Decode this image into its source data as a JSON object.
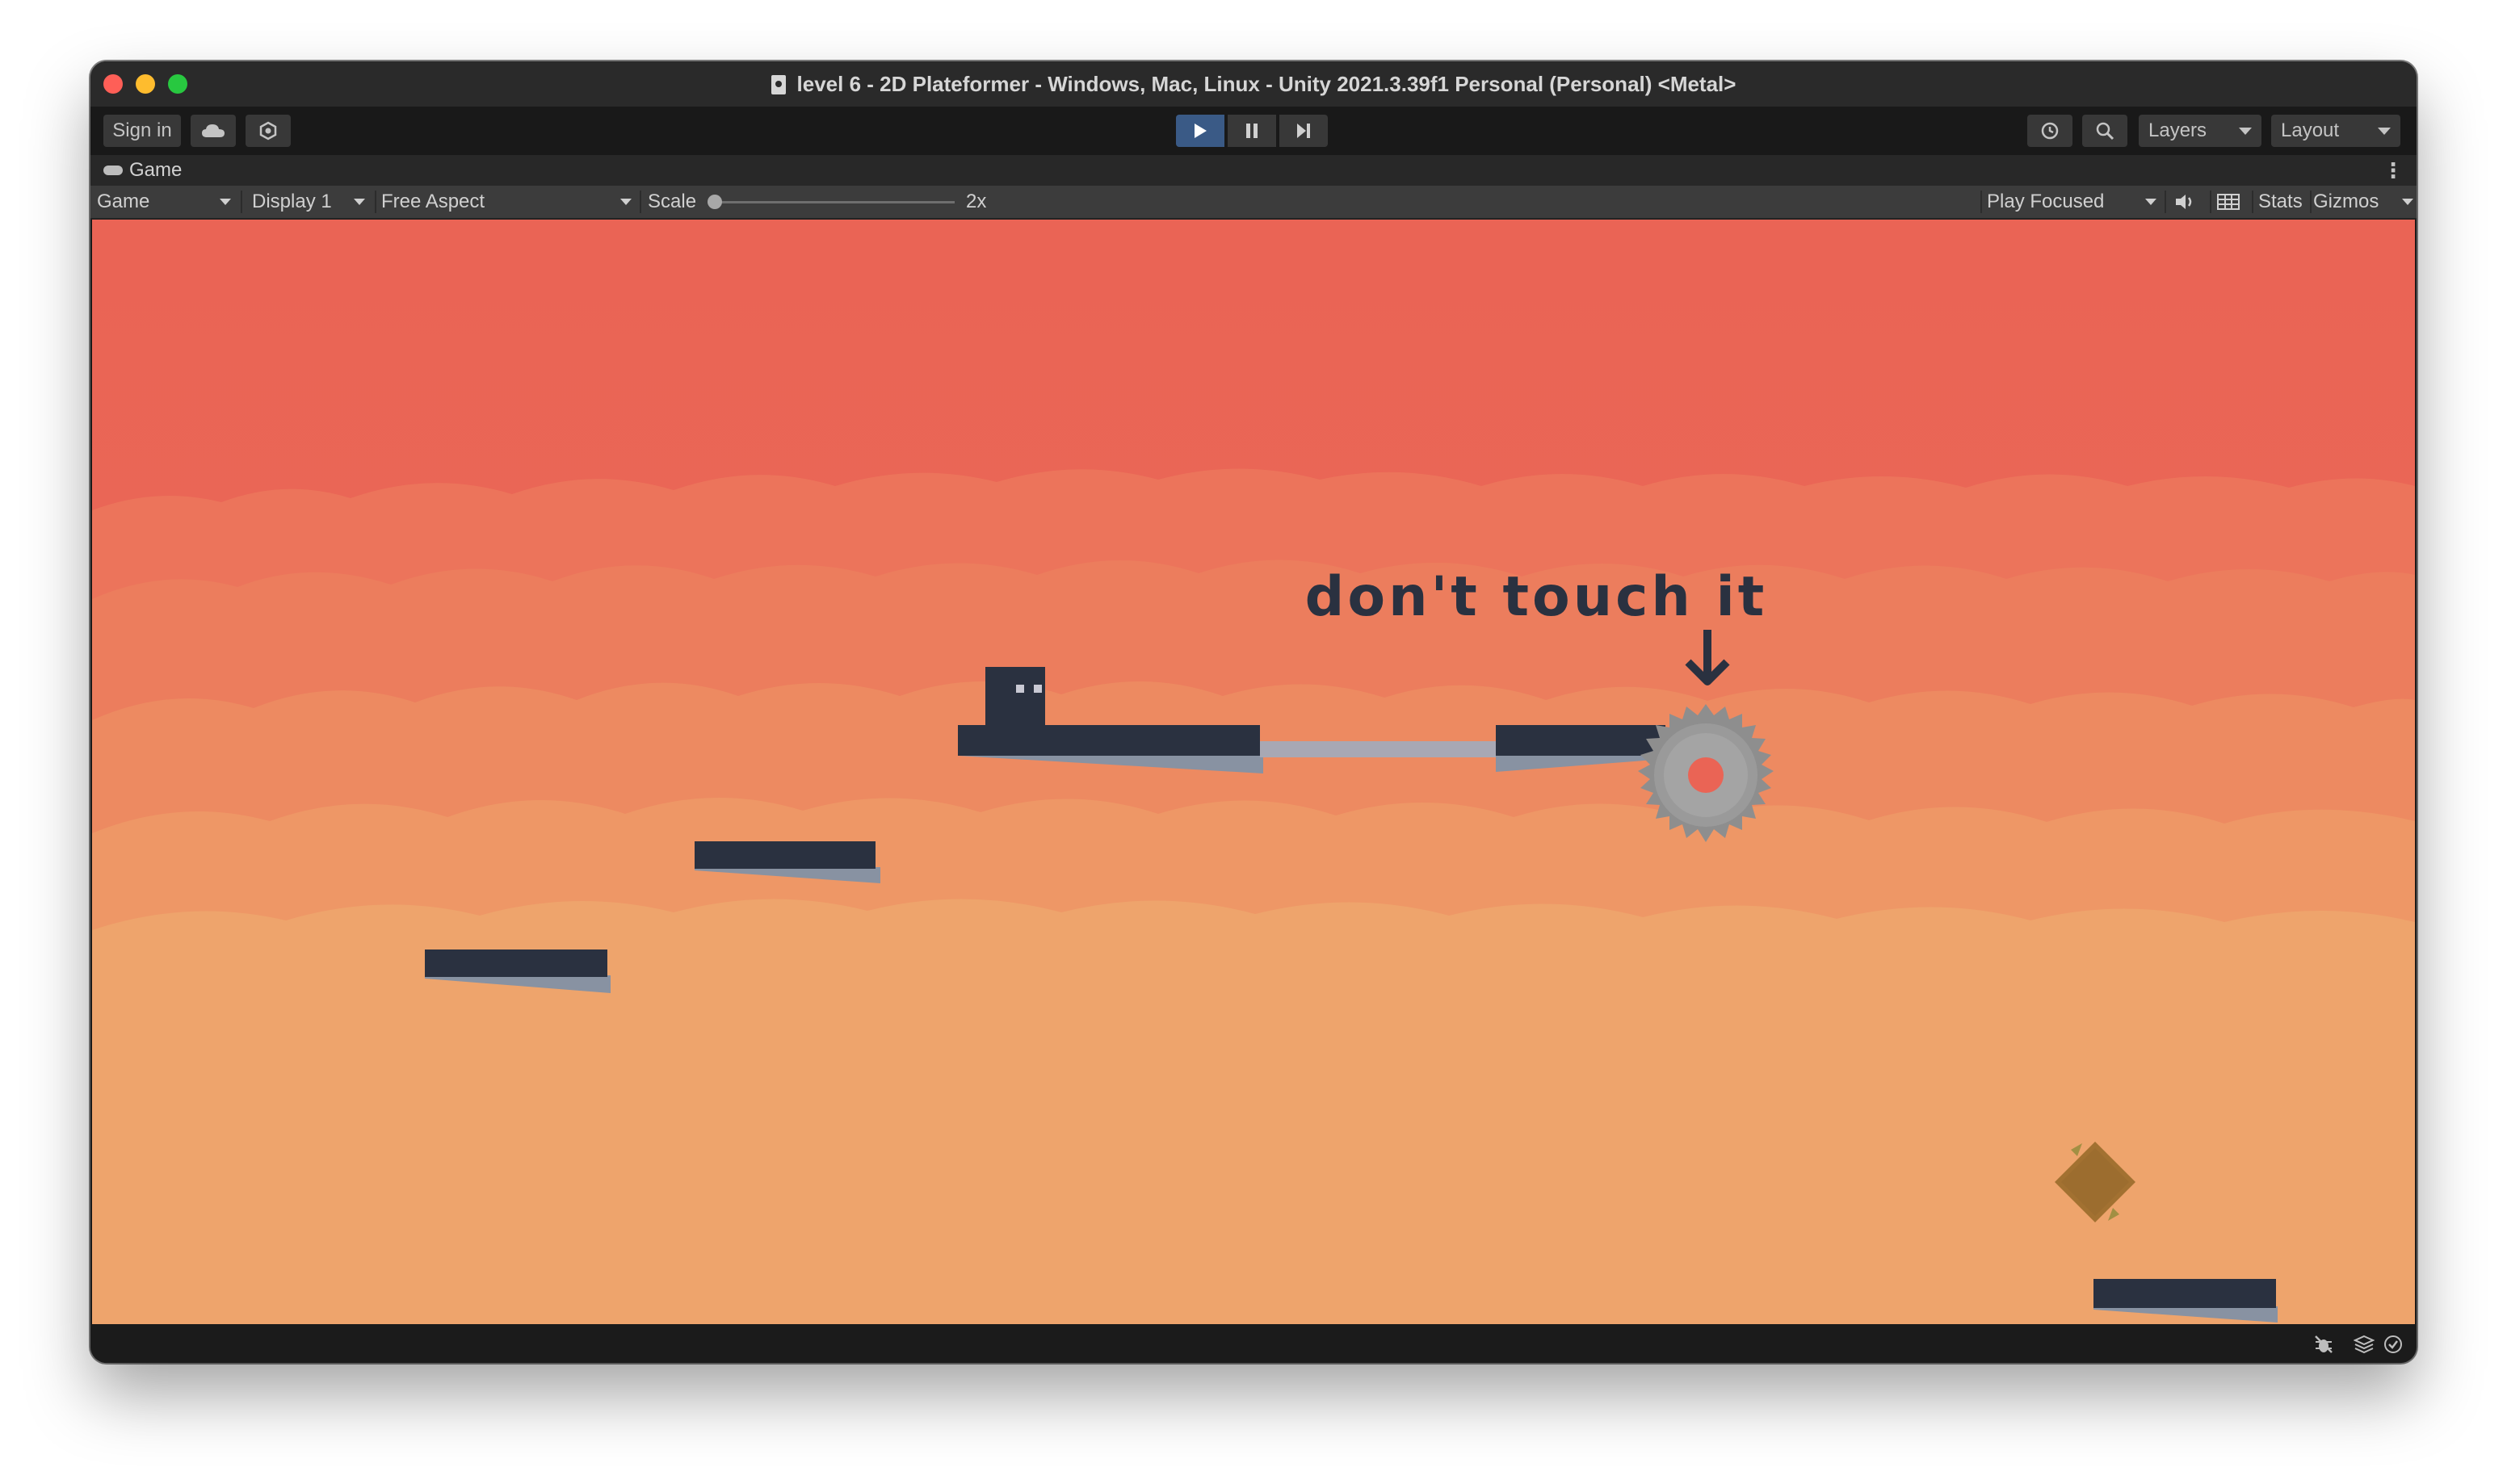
{
  "window": {
    "title": "level 6 - 2D Plateformer - Windows, Mac, Linux - Unity 2021.3.39f1 Personal (Personal) <Metal>"
  },
  "toolbar": {
    "sign_in": "Sign in",
    "layers": "Layers",
    "layout": "Layout"
  },
  "tab": {
    "game": "Game"
  },
  "game_toolbar": {
    "mode": "Game",
    "display": "Display 1",
    "aspect": "Free Aspect",
    "scale_label": "Scale",
    "scale_value": "2x",
    "play_mode": "Play Focused",
    "stats": "Stats",
    "gizmos": "Gizmos"
  },
  "scene": {
    "hint_text": "don't touch it",
    "colors": {
      "sky_top": "#ea6455",
      "sky_bottom": "#eea46c",
      "platform": "#2a3140",
      "platform_shadow": "#8892a2",
      "bridge": "#a8a8b4",
      "saw": "#8e8e8e",
      "saw_center": "#ea6455",
      "goal": "#a27131"
    }
  },
  "icons": {
    "cloud": "cloud-icon",
    "services": "services-icon",
    "play": "play-icon",
    "pause": "pause-icon",
    "step": "step-icon",
    "history": "history-icon",
    "search": "search-icon",
    "gamepad": "gamepad-icon",
    "kebab": "kebab-menu-icon",
    "audio": "audio-icon",
    "grid": "grid-icon",
    "bug": "bug-icon",
    "layers_stack": "layers-stack-icon",
    "check": "check-circle-icon"
  }
}
